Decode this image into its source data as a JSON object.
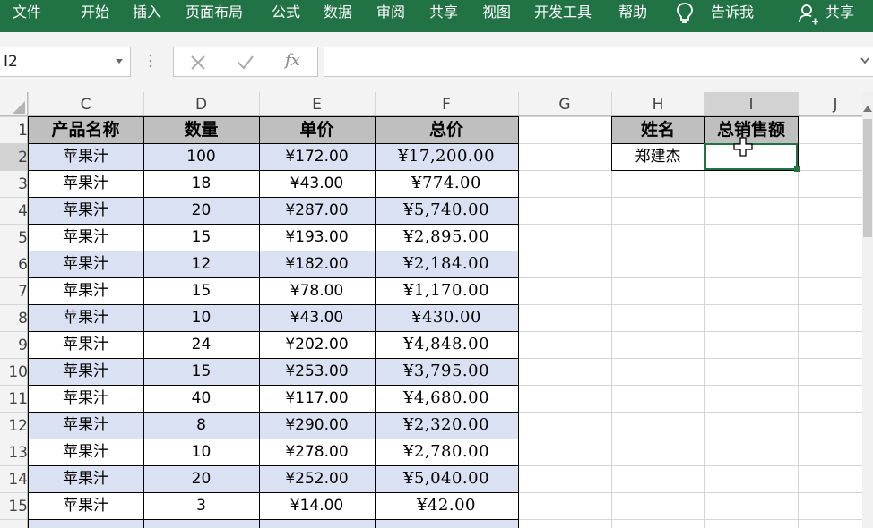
{
  "ribbon": {
    "menus": [
      "文件",
      "开始",
      "插入",
      "页面布局",
      "公式",
      "数据",
      "审阅",
      "共享",
      "视图",
      "开发工具",
      "帮助"
    ],
    "tell_me": "告诉我",
    "share": "共享"
  },
  "formula_bar": {
    "name_box": "I2",
    "fx_label": "fx",
    "formula": ""
  },
  "columns": [
    "C",
    "D",
    "E",
    "F",
    "G",
    "H",
    "I",
    "J"
  ],
  "rows": [
    "1",
    "2",
    "3",
    "4",
    "5",
    "6",
    "7",
    "8",
    "9",
    "10",
    "11",
    "12",
    "13",
    "14",
    "15"
  ],
  "table": {
    "headers": [
      "产品名称",
      "数量",
      "单价",
      "总价"
    ],
    "rows": [
      [
        "苹果汁",
        "100",
        "¥172.00",
        "¥17,200.00"
      ],
      [
        "苹果汁",
        "18",
        "¥43.00",
        "¥774.00"
      ],
      [
        "苹果汁",
        "20",
        "¥287.00",
        "¥5,740.00"
      ],
      [
        "苹果汁",
        "15",
        "¥193.00",
        "¥2,895.00"
      ],
      [
        "苹果汁",
        "12",
        "¥182.00",
        "¥2,184.00"
      ],
      [
        "苹果汁",
        "15",
        "¥78.00",
        "¥1,170.00"
      ],
      [
        "苹果汁",
        "10",
        "¥43.00",
        "¥430.00"
      ],
      [
        "苹果汁",
        "24",
        "¥202.00",
        "¥4,848.00"
      ],
      [
        "苹果汁",
        "15",
        "¥253.00",
        "¥3,795.00"
      ],
      [
        "苹果汁",
        "40",
        "¥117.00",
        "¥4,680.00"
      ],
      [
        "苹果汁",
        "8",
        "¥290.00",
        "¥2,320.00"
      ],
      [
        "苹果汁",
        "10",
        "¥278.00",
        "¥2,780.00"
      ],
      [
        "苹果汁",
        "20",
        "¥252.00",
        "¥5,040.00"
      ],
      [
        "苹果汁",
        "3",
        "¥14.00",
        "¥42.00"
      ]
    ]
  },
  "lookup": {
    "headers": [
      "姓名",
      "总销售额"
    ],
    "name": "郑建杰",
    "total": ""
  },
  "colors": {
    "ribbon": "#217346",
    "header_fill": "#bfbfbf",
    "band_fill": "#d9e1f2",
    "selection": "#217346"
  }
}
